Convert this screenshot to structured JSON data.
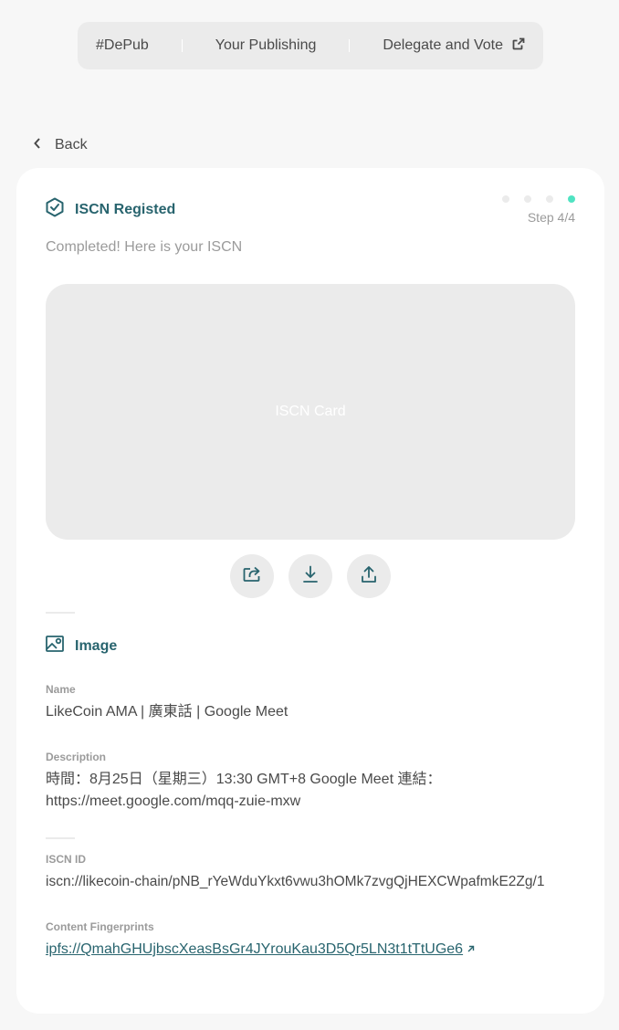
{
  "nav": {
    "items": [
      {
        "label": "#DePub"
      },
      {
        "label": "Your Publishing"
      },
      {
        "label": "Delegate and Vote",
        "icon": "external-link-icon"
      }
    ]
  },
  "back": {
    "label": "Back",
    "icon": "chevron-left-icon"
  },
  "registration": {
    "title": "ISCN Registed",
    "title_icon": "shield-check-icon",
    "step": {
      "current": 4,
      "total": 4,
      "label": "Step 4/4"
    },
    "subtitle": "Completed! Here is your ISCN",
    "card_placeholder": "ISCN Card",
    "actions": [
      {
        "icon": "share-icon"
      },
      {
        "icon": "download-icon"
      },
      {
        "icon": "upload-icon"
      }
    ]
  },
  "section": {
    "title": "Image",
    "icon": "image-icon"
  },
  "fields": {
    "name_label": "Name",
    "name_value": "LikeCoin AMA | 廣東話 | Google Meet",
    "description_label": "Description",
    "description_value": "時間：8月25日（星期三）13:30 GMT+8 Google Meet 連結：https://meet.google.com/mqq-zuie-mxw",
    "iscn_id_label": "ISCN ID",
    "iscn_id_value": "iscn://likecoin-chain/pNB_rYeWduYkxt6vwu3hOMk7zvgQjHEXCWpafmkE2Zg/1",
    "fingerprint_label": "Content Fingerprints",
    "fingerprint_value": "ipfs://QmahGHUjbscXeasBsGr4JYrouKau3D5Qr5LN3t1tTtUGe6"
  },
  "colors": {
    "accent": "#28646e",
    "active_dot": "#50e3c2",
    "muted": "#9b9b9b",
    "surface": "#ebebeb"
  }
}
